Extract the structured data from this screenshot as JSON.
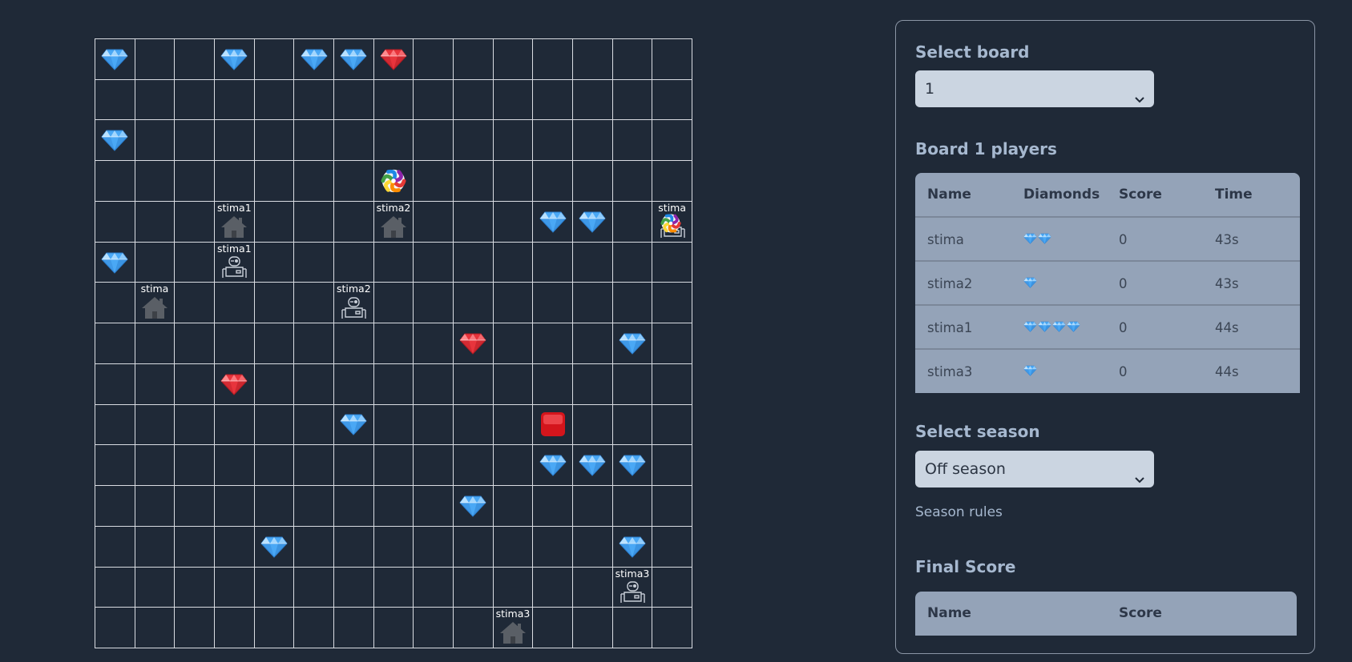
{
  "board": {
    "size": 15,
    "cells": [
      {
        "row": 0,
        "col": 0,
        "type": "diamond-blue"
      },
      {
        "row": 0,
        "col": 3,
        "type": "diamond-blue"
      },
      {
        "row": 0,
        "col": 5,
        "type": "diamond-blue"
      },
      {
        "row": 0,
        "col": 6,
        "type": "diamond-blue"
      },
      {
        "row": 0,
        "col": 7,
        "type": "diamond-red"
      },
      {
        "row": 2,
        "col": 0,
        "type": "diamond-blue"
      },
      {
        "row": 3,
        "col": 7,
        "type": "teleporter"
      },
      {
        "row": 4,
        "col": 3,
        "type": "base",
        "label": "stima1"
      },
      {
        "row": 4,
        "col": 7,
        "type": "base",
        "label": "stima2"
      },
      {
        "row": 4,
        "col": 11,
        "type": "diamond-blue"
      },
      {
        "row": 4,
        "col": 12,
        "type": "diamond-blue"
      },
      {
        "row": 4,
        "col": 14,
        "type": "bot-on-teleporter",
        "label": "stima"
      },
      {
        "row": 5,
        "col": 0,
        "type": "diamond-blue"
      },
      {
        "row": 5,
        "col": 3,
        "type": "bot",
        "label": "stima1"
      },
      {
        "row": 6,
        "col": 1,
        "type": "base",
        "label": "stima"
      },
      {
        "row": 6,
        "col": 6,
        "type": "bot",
        "label": "stima2"
      },
      {
        "row": 7,
        "col": 9,
        "type": "diamond-red"
      },
      {
        "row": 7,
        "col": 13,
        "type": "diamond-blue"
      },
      {
        "row": 8,
        "col": 3,
        "type": "diamond-red"
      },
      {
        "row": 9,
        "col": 6,
        "type": "diamond-blue"
      },
      {
        "row": 9,
        "col": 11,
        "type": "reset-button"
      },
      {
        "row": 10,
        "col": 11,
        "type": "diamond-blue"
      },
      {
        "row": 10,
        "col": 12,
        "type": "diamond-blue"
      },
      {
        "row": 10,
        "col": 13,
        "type": "diamond-blue"
      },
      {
        "row": 11,
        "col": 9,
        "type": "diamond-blue"
      },
      {
        "row": 12,
        "col": 4,
        "type": "diamond-blue"
      },
      {
        "row": 12,
        "col": 13,
        "type": "diamond-blue"
      },
      {
        "row": 13,
        "col": 13,
        "type": "bot",
        "label": "stima3"
      },
      {
        "row": 14,
        "col": 10,
        "type": "base",
        "label": "stima3"
      }
    ]
  },
  "panel": {
    "select_board_heading": "Select board",
    "board_select_value": "1",
    "players_heading": "Board 1 players",
    "players_table": {
      "headers": [
        "Name",
        "Diamonds",
        "Score",
        "Time"
      ],
      "rows": [
        {
          "name": "stima",
          "diamonds": 2,
          "score": "0",
          "time": "43s"
        },
        {
          "name": "stima2",
          "diamonds": 1,
          "score": "0",
          "time": "43s"
        },
        {
          "name": "stima1",
          "diamonds": 4,
          "score": "0",
          "time": "44s"
        },
        {
          "name": "stima3",
          "diamonds": 1,
          "score": "0",
          "time": "44s"
        }
      ]
    },
    "select_season_heading": "Select season",
    "season_select_value": "Off season",
    "season_rules_link": "Season rules",
    "final_score_heading": "Final Score",
    "final_score_table": {
      "headers": [
        "Name",
        "Score"
      ]
    }
  },
  "colors": {
    "background": "#1f2937",
    "grid_line": "#d9dce2",
    "heading": "#a6b8cf",
    "table_bg": "#94a3b8",
    "select_bg": "#cbd5e1",
    "diamond_blue": "#4aa8f5",
    "diamond_red": "#e8343c",
    "base_icon": "#5a5f66"
  }
}
